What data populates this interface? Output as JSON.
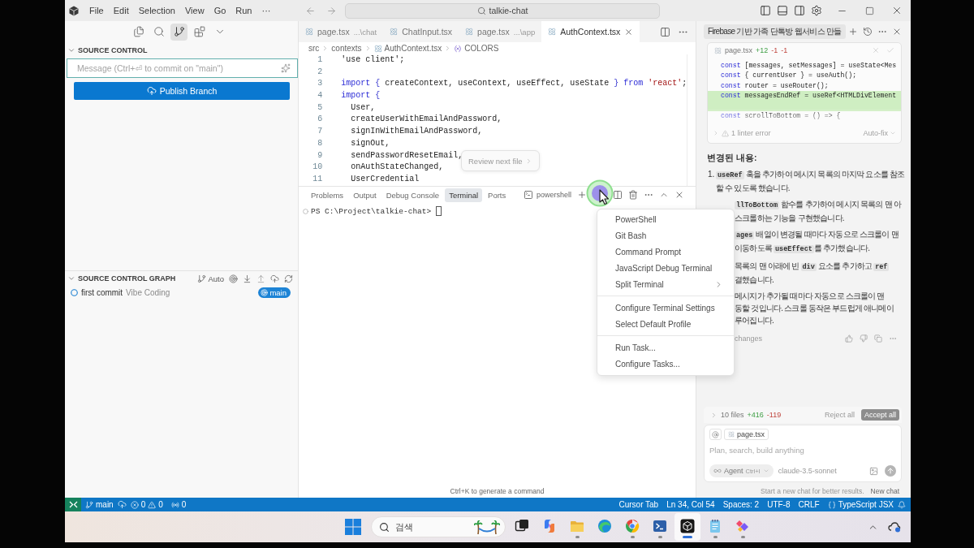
{
  "title_bar": {
    "menu": [
      "File",
      "Edit",
      "Selection",
      "View",
      "Go",
      "Run",
      "···"
    ],
    "search": "talkie-chat"
  },
  "activity_bar": [
    {
      "selected": false
    },
    {
      "selected": false
    },
    {
      "selected": true
    },
    {
      "selected": false
    },
    {
      "selected": false
    }
  ],
  "source_control": {
    "title": "SOURCE CONTROL",
    "message_field": {
      "placeholder": "Message (Ctrl+⏎ to commit on \"main\")"
    },
    "publish_button": "Publish Branch"
  },
  "source_control_graph": {
    "title": "SOURCE CONTROL GRAPH",
    "filter": "Auto",
    "commits": [
      {
        "message": "first commit",
        "author": "Vibe Coding",
        "branch": "main"
      }
    ]
  },
  "editor": {
    "tabs": [
      {
        "label": "page.tsx",
        "path": "...\\chat",
        "selected": false
      },
      {
        "label": "ChatInput.tsx",
        "selected": false
      },
      {
        "label": "page.tsx",
        "path": "...\\app",
        "selected": false
      },
      {
        "label": "AuthContext.tsx",
        "selected": true
      }
    ],
    "breadcrumb": [
      "src",
      "contexts",
      "AuthContext.tsx",
      "COLORS"
    ],
    "code": [
      {
        "number": "1",
        "tokens": [
          {
            "text": "'use client';",
            "kind": "plain"
          }
        ]
      },
      {
        "number": "2"
      },
      {
        "number": "3",
        "tokens": [
          {
            "text": "import ",
            "kind": "keyword"
          },
          {
            "text": "{",
            "kind": "bracket"
          },
          {
            "text": " createContext, useContext, useEffect, useState ",
            "kind": "plain"
          },
          {
            "text": "}",
            "kind": "bracket"
          },
          {
            "text": " from ",
            "kind": "keyword"
          },
          {
            "text": "'react'",
            "kind": "string"
          },
          {
            "text": ";",
            "kind": "plain"
          }
        ]
      },
      {
        "number": "4",
        "tokens": [
          {
            "text": "import ",
            "kind": "keyword"
          },
          {
            "text": "{",
            "kind": "bracket"
          }
        ]
      },
      {
        "number": "5",
        "tokens": [
          {
            "text": "  User,",
            "kind": "plain"
          }
        ]
      },
      {
        "number": "6",
        "tokens": [
          {
            "text": "  createUserWithEmailAndPassword,",
            "kind": "plain"
          }
        ]
      },
      {
        "number": "7",
        "tokens": [
          {
            "text": "  signInWithEmailAndPassword,",
            "kind": "plain"
          }
        ]
      },
      {
        "number": "8",
        "tokens": [
          {
            "text": "  signOut,",
            "kind": "plain"
          }
        ]
      },
      {
        "number": "9",
        "tokens": [
          {
            "text": "  sendPasswordResetEmail,",
            "kind": "plain"
          }
        ]
      },
      {
        "number": "10",
        "tokens": [
          {
            "text": "  onAuthStateChanged,",
            "kind": "plain"
          }
        ]
      },
      {
        "number": "11",
        "tokens": [
          {
            "text": "  UserCredential",
            "kind": "plain"
          }
        ]
      }
    ],
    "review_popup": "Review next file"
  },
  "panel": {
    "tabs": [
      {
        "label": "Problems",
        "selected": false
      },
      {
        "label": "Output",
        "selected": false
      },
      {
        "label": "Debug Console",
        "selected": false
      },
      {
        "label": "Terminal",
        "selected": true
      },
      {
        "label": "Ports",
        "selected": false
      }
    ],
    "terminal_name": "powershell",
    "prompt": "PS C:\\Project\\talkie-chat>",
    "hint": "Ctrl+K to generate a command"
  },
  "terminal_menu": {
    "groups": [
      {
        "items": [
          {
            "label": "PowerShell",
            "submenu": false
          },
          {
            "label": "Git Bash",
            "submenu": false
          },
          {
            "label": "Command Prompt",
            "submenu": false
          },
          {
            "label": "JavaScript Debug Terminal",
            "submenu": false
          },
          {
            "label": "Split Terminal",
            "submenu": true
          }
        ]
      },
      {
        "items": [
          {
            "label": "Configure Terminal Settings",
            "submenu": false
          },
          {
            "label": "Select Default Profile",
            "submenu": false
          }
        ]
      },
      {
        "items": [
          {
            "label": "Run Task...",
            "submenu": false
          },
          {
            "label": "Configure Tasks...",
            "submenu": false
          }
        ]
      }
    ]
  },
  "chat": {
    "title": "Firebase 기반 가족 단톡방 웹서비스 만들",
    "diff": {
      "file": "page.tsx",
      "stats": [
        {
          "text": "+12",
          "kind": "added"
        },
        {
          "text": "-1",
          "kind": "removed"
        },
        {
          "text": "-1",
          "kind": "removed"
        }
      ],
      "lines": [
        {
          "tokens": [
            {
              "text": "const",
              "kind": "keyword"
            },
            {
              "text": " [messages, setMessages] = useState<Mes",
              "kind": "plain"
            }
          ],
          "added": false
        },
        {
          "tokens": [
            {
              "text": "const",
              "kind": "keyword"
            },
            {
              "text": " { currentUser } = useAuth();",
              "kind": "plain"
            }
          ],
          "added": false
        },
        {
          "tokens": [
            {
              "text": "const",
              "kind": "keyword"
            },
            {
              "text": " router = useRouter();",
              "kind": "plain"
            }
          ],
          "added": false
        },
        {
          "tokens": [
            {
              "text": "const",
              "kind": "keyword"
            },
            {
              "text": " messagesEndRef = useRef<HTMLDivElement",
              "kind": "plain"
            }
          ],
          "added": true
        },
        {
          "added": true
        },
        {
          "tokens": [
            {
              "text": "const",
              "kind": "keyword"
            },
            {
              "text": " scrollToBottom = () => {",
              "kind": "plain"
            }
          ],
          "added": false
        }
      ],
      "linter": "1 linter error",
      "autofix": "Auto-fix"
    },
    "summary_title": "변경된 내용:",
    "changes": [
      {
        "number": "1.",
        "lines": [
          [
            {
              "text": "useRef",
              "code": true
            },
            {
              "text": " 훅을 추가하여 메시지 목록의 마지막 요소를 참조할 수 있도록 했습니다.",
              "code": false
            }
          ]
        ]
      },
      {
        "lines": [
          [
            {
              "text": "llToBottom",
              "code": true
            },
            {
              "text": " 함수를 추가하여 메시지 목록의 맨 아",
              "code": false
            }
          ],
          [
            {
              "text": "스크롤하는 기능을 구현했습니다.",
              "code": false
            }
          ]
        ]
      },
      {
        "lines": [
          [
            {
              "text": "ages",
              "code": true
            },
            {
              "text": " 배열이 변경될 때마다 자동으로 스크롤이 맨",
              "code": false
            }
          ],
          [
            {
              "text": "이동하도록 ",
              "code": false
            },
            {
              "text": "useEffect",
              "code": true
            },
            {
              "text": "를 추가했습니다.",
              "code": false
            }
          ]
        ]
      },
      {
        "lines": [
          [
            {
              "text": "목록의 맨 아래에 빈 ",
              "code": false
            },
            {
              "text": "div",
              "code": true
            },
            {
              "text": " 요소를 추가하고 ",
              "code": false
            },
            {
              "text": "ref",
              "code": true
            }
          ],
          [
            {
              "text": "결했습니다.",
              "code": false
            }
          ]
        ]
      },
      {
        "lines": [
          [
            {
              "text": "메시지가 추가될 때마다 자동으로 스크롤이 맨",
              "code": false
            }
          ],
          [
            {
              "text": "동할 것입니다. 스크롤 동작은 부드럽게 애니메이",
              "code": false
            }
          ],
          [
            {
              "text": "루어집니다.",
              "code": false
            }
          ]
        ]
      }
    ],
    "changes_label": "changes",
    "files_bar": {
      "count": "10 files",
      "added": "+416",
      "removed": "-119",
      "reject": "Reject all",
      "accept": "Accept all"
    },
    "composer": {
      "context_file": "page.tsx",
      "placeholder": "Plan, search, build anything",
      "mode": "Agent",
      "mode_shortcut": "Ctrl+I",
      "model": "claude-3.5-sonnet"
    },
    "footer": {
      "hint": "Start a new chat for better results.",
      "new_chat": "New chat"
    }
  },
  "status_bar": {
    "branch": "main",
    "errors": "0",
    "warnings": "0",
    "ports": "0",
    "right": [
      "Cursor Tab",
      "Ln 34, Col 54",
      "Spaces: 2",
      "UTF-8",
      "CRLF"
    ],
    "language": "TypeScript JSX"
  },
  "taskbar": {
    "search": {
      "placeholder": "검색"
    },
    "apps": [
      {
        "running": false,
        "selected": false
      },
      {
        "running": false,
        "selected": false
      },
      {
        "running": true,
        "selected": false
      },
      {
        "running": false,
        "selected": false
      },
      {
        "running": true,
        "selected": false
      },
      {
        "running": true,
        "selected": false
      },
      {
        "running": true,
        "selected": true
      },
      {
        "running": true,
        "selected": false
      },
      {
        "running": true,
        "selected": false
      }
    ]
  }
}
